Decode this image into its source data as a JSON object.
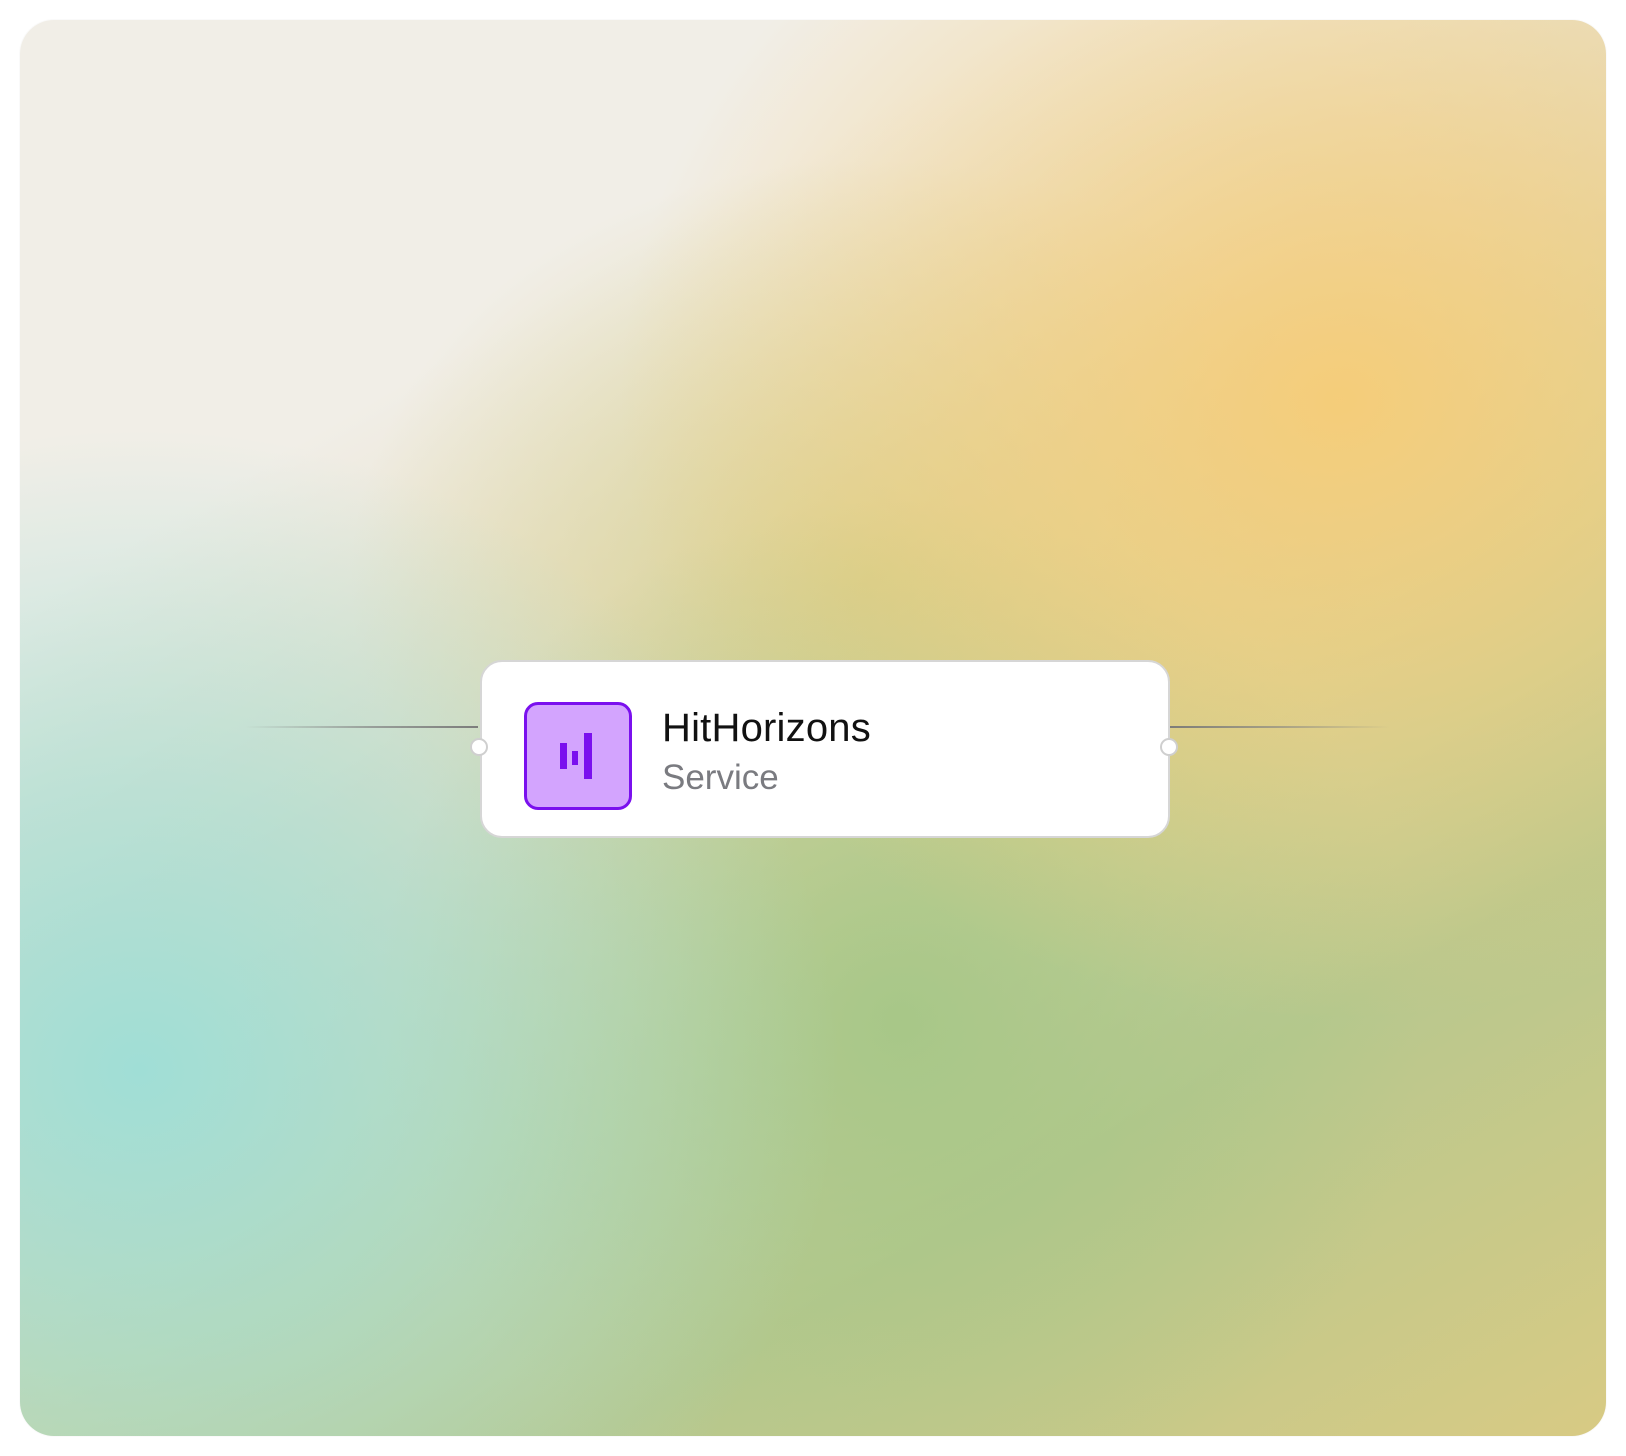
{
  "node": {
    "title": "HitHorizons",
    "subtitle": "Service",
    "icon": "hithorizons-logo-icon",
    "logo_background": "#d3a4fe",
    "logo_accent": "#7a10ee"
  },
  "background": {
    "colors": [
      "#f1eee7",
      "#f6cc76",
      "#a0ded6",
      "#a4c686"
    ]
  }
}
